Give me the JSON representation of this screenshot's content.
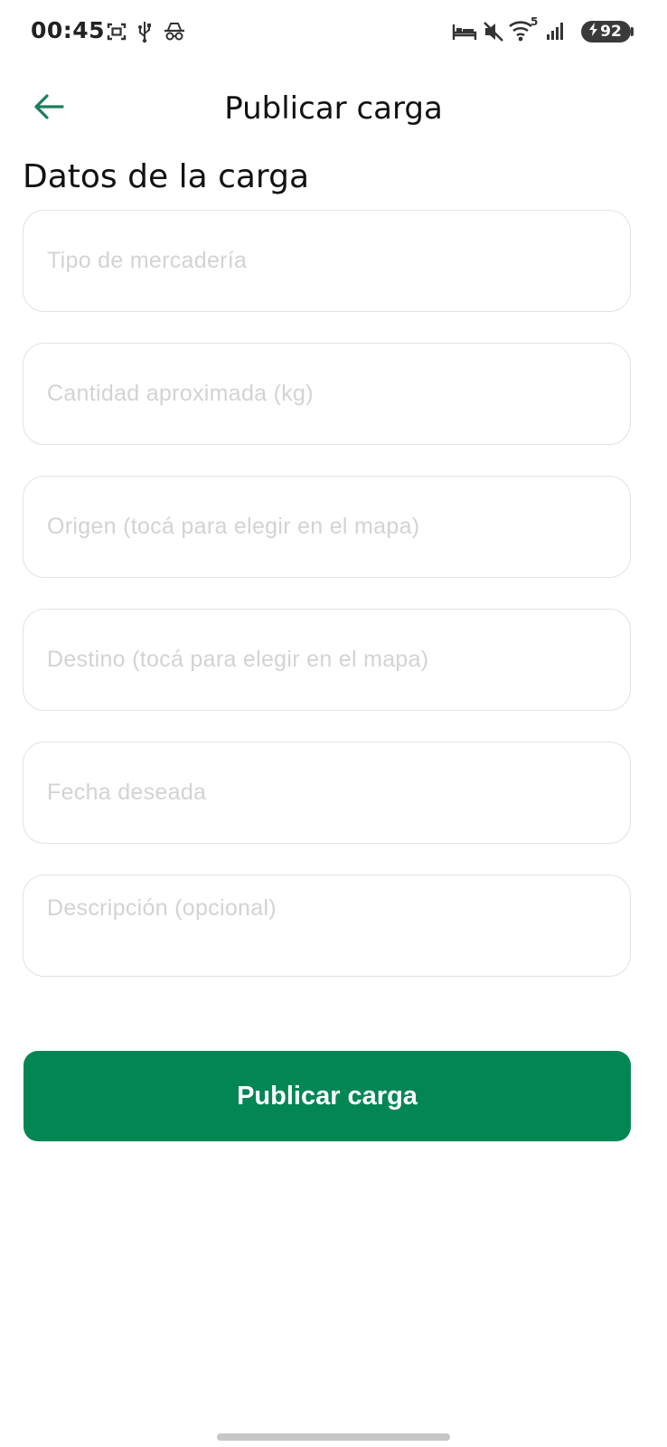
{
  "status_bar": {
    "time": "00:45",
    "battery_level": "92",
    "wifi_badge": "5",
    "icons": [
      "screenshot-icon",
      "usb-icon",
      "incognito-icon",
      "bed-icon",
      "mute-icon",
      "wifi-icon",
      "signal-icon",
      "charging-bolt-icon"
    ]
  },
  "app_bar": {
    "title": "Publicar carga",
    "back_icon": "arrow-left-icon",
    "accent_color": "#1a7f5a"
  },
  "form": {
    "section_title": "Datos de la carga",
    "fields": [
      {
        "placeholder": "Tipo de mercadería",
        "value": ""
      },
      {
        "placeholder": "Cantidad aproximada (kg)",
        "value": ""
      },
      {
        "placeholder": "Origen (tocá para elegir en el mapa)",
        "value": ""
      },
      {
        "placeholder": "Destino (tocá para elegir en el mapa)",
        "value": ""
      },
      {
        "placeholder": "Fecha deseada",
        "value": ""
      },
      {
        "placeholder": "Descripción (opcional)",
        "value": ""
      }
    ],
    "submit_label": "Publicar carga",
    "submit_color": "#028654"
  }
}
